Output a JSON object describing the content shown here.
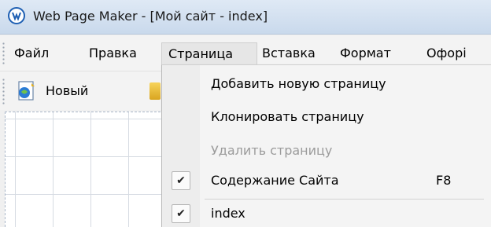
{
  "window": {
    "title": "Web Page Maker - [Мой сайт - index]",
    "icon": "app-logo-icon"
  },
  "menubar": {
    "items": [
      {
        "label": "Файл"
      },
      {
        "label": "Правка"
      },
      {
        "label": "Страница",
        "active": true
      },
      {
        "label": "Вставка"
      },
      {
        "label": "Формат"
      },
      {
        "label": "Офорі"
      }
    ]
  },
  "toolbar": {
    "new_label": "Новый",
    "new_icon": "new-page-icon"
  },
  "dropdown": {
    "items": [
      {
        "label": "Добавить новую страницу",
        "enabled": true
      },
      {
        "label": "Клонировать страницу",
        "enabled": true
      },
      {
        "label": "Удалить страницу",
        "enabled": false
      },
      {
        "label": "Содержание Сайта",
        "shortcut": "F8",
        "checked": true
      },
      {
        "label": "index",
        "checked": true
      }
    ],
    "check_glyph": "✔"
  },
  "colors": {
    "titlebar": "#c9d9ec",
    "menu_bg": "#f3f3f3",
    "disabled_text": "#9b9b9b"
  }
}
